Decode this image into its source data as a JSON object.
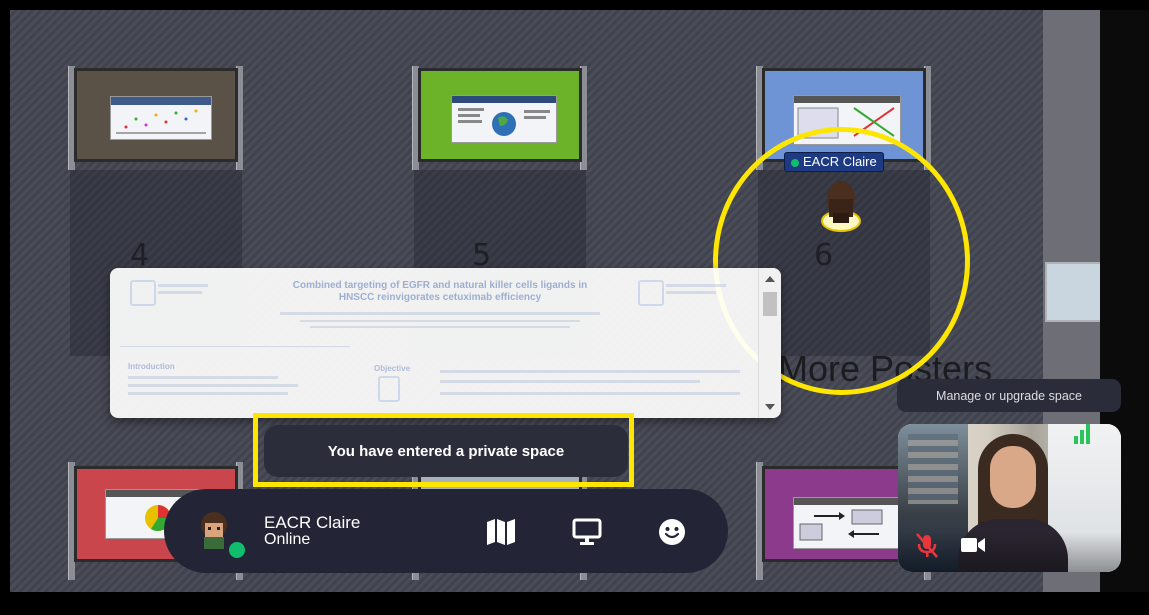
{
  "booths": [
    {
      "number": "4",
      "board_color": "#5a5247"
    },
    {
      "number": "5",
      "board_color": "#6cb32a"
    },
    {
      "number": "6",
      "board_color": "#6f94d6"
    }
  ],
  "lower_booths": [
    {
      "board_color": "#c9474c"
    },
    {
      "board_color": "#a8b3bd"
    },
    {
      "board_color": "#8c3b8c"
    }
  ],
  "poster_preview": {
    "title": "Combined targeting of EGFR and natural killer cells ligands in HNSCC reinvigorates cetuximab efficiency",
    "sections": [
      "Introduction",
      "Objective"
    ]
  },
  "area_label": "More Posters",
  "toast": {
    "message": "You have entered a private space"
  },
  "player": {
    "name": "EACR Claire",
    "status": "Online",
    "label": "EACR Claire"
  },
  "controls": {
    "map": "map-icon",
    "screen": "screen-share-icon",
    "emote": "emoji-icon"
  },
  "tooltip": {
    "text": "Manage or upgrade space"
  },
  "video": {
    "mic": "muted",
    "camera": "on",
    "accent": "#29c45a"
  },
  "highlight_color": "#ffe600"
}
